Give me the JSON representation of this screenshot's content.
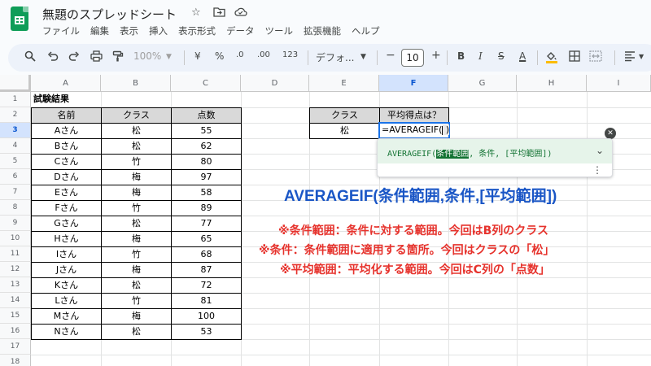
{
  "app": {
    "doc_title": "無題のスプレッドシート",
    "menu": [
      "ファイル",
      "編集",
      "表示",
      "挿入",
      "表示形式",
      "データ",
      "ツール",
      "拡張機能",
      "ヘルプ"
    ]
  },
  "toolbar": {
    "zoom": "100%",
    "currency": "¥",
    "percent": "%",
    "dec_dec": ".0",
    "dec_inc": ".00",
    "format_123": "123",
    "font": "デフォ...",
    "font_size": "10",
    "bold": "B",
    "italic": "I",
    "strike": "S",
    "text_color": "A"
  },
  "grid": {
    "columns": [
      "A",
      "B",
      "C",
      "D",
      "E",
      "F",
      "G",
      "H",
      "I"
    ],
    "selected_column": "F",
    "rows": [
      "1",
      "2",
      "3",
      "4",
      "5",
      "6",
      "7",
      "8",
      "9",
      "10",
      "11",
      "12",
      "13",
      "14",
      "15",
      "16",
      "17",
      "18"
    ],
    "selected_row": "3"
  },
  "sheet": {
    "title_cell": "試験結果",
    "headers": [
      "名前",
      "クラス",
      "点数"
    ],
    "records": [
      {
        "name": "Aさん",
        "cls": "松",
        "score": "55"
      },
      {
        "name": "Bさん",
        "cls": "松",
        "score": "62"
      },
      {
        "name": "Cさん",
        "cls": "竹",
        "score": "80"
      },
      {
        "name": "Dさん",
        "cls": "梅",
        "score": "97"
      },
      {
        "name": "Eさん",
        "cls": "梅",
        "score": "58"
      },
      {
        "name": "Fさん",
        "cls": "竹",
        "score": "89"
      },
      {
        "name": "Gさん",
        "cls": "松",
        "score": "77"
      },
      {
        "name": "Hさん",
        "cls": "梅",
        "score": "65"
      },
      {
        "name": "Iさん",
        "cls": "竹",
        "score": "68"
      },
      {
        "name": "Jさん",
        "cls": "梅",
        "score": "87"
      },
      {
        "name": "Kさん",
        "cls": "松",
        "score": "72"
      },
      {
        "name": "Lさん",
        "cls": "竹",
        "score": "81"
      },
      {
        "name": "Mさん",
        "cls": "梅",
        "score": "100"
      },
      {
        "name": "Nさん",
        "cls": "松",
        "score": "53"
      }
    ],
    "lookup_header_class": "クラス",
    "lookup_header_avg": "平均得点は？",
    "lookup_class_value": "松",
    "formula_input": "=AVERAGEIF("
  },
  "formula_help": {
    "fn_open": "AVERAGEIF(",
    "arg1": "条件範囲",
    "rest": ", 条件, [平均範囲])"
  },
  "annotation": {
    "title": "AVERAGEIF(条件範囲,条件,[平均範囲])",
    "lines": [
      "※条件範囲：条件に対する範囲。今回はB列のクラス",
      "※条件：条件範囲に適用する箇所。今回はクラスの「松」",
      "※平均範囲：平均化する範囲。今回はC列の「点数」"
    ]
  },
  "colors": {
    "accent_blue": "#1a73e8",
    "annotation_blue": "#1a56c6",
    "annotation_red": "#e6322c",
    "help_green": "#137333",
    "header_gray": "#d9d9d9",
    "sheets_green": "#0f9d58"
  },
  "icons": {
    "star": "star-icon",
    "move": "move-to-folder-icon",
    "cloud": "cloud-status-icon",
    "search": "search-icon",
    "undo": "undo-icon",
    "redo": "redo-icon",
    "print": "print-icon",
    "paint_format": "paint-format-icon"
  }
}
